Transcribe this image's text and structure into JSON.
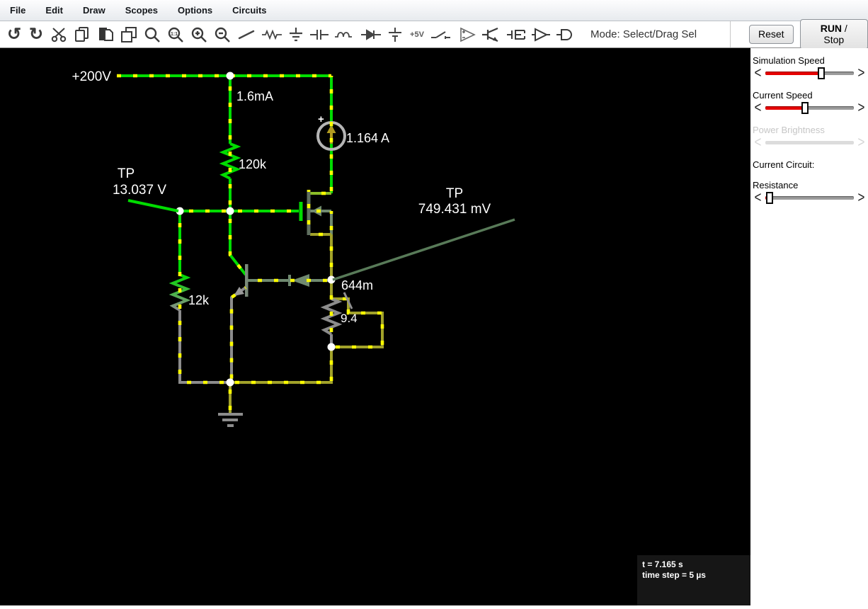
{
  "menu": {
    "items": [
      "File",
      "Edit",
      "Draw",
      "Scopes",
      "Options",
      "Circuits"
    ]
  },
  "toolbar": {
    "edit_icons": [
      "undo",
      "redo",
      "cut",
      "copy",
      "paste",
      "duplicate",
      "search",
      "zoom-100",
      "zoom-in",
      "zoom-out"
    ],
    "component_icons": [
      "wire",
      "resistor",
      "ground",
      "capacitor",
      "inductor",
      "diode",
      "voltage-source",
      "plus-5v",
      "switch",
      "op-amp",
      "transistor",
      "mosfet",
      "buffer",
      "logic-gate"
    ],
    "undo_glyph": "↺",
    "redo_glyph": "↻",
    "zoom100_label": "1:1",
    "plus5v_label": "+5V",
    "mode_label": "Mode: Select/Drag Sel",
    "reset_label": "Reset",
    "run_strong": "RUN",
    "run_rest": " / Stop"
  },
  "side_panel": {
    "sim_speed": {
      "label": "Simulation Speed",
      "fill_pct": 63
    },
    "current_speed": {
      "label": "Current Speed",
      "fill_pct": 45
    },
    "power_brightness": {
      "label": "Power Brightness",
      "fill_pct": null
    },
    "current_circuit_label": "Current Circuit:",
    "resistance": {
      "label": "Resistance",
      "fill_pct": 5
    }
  },
  "status": {
    "time": "t = 7.165 s",
    "timestep": "time step = 5 µs"
  },
  "circuit": {
    "labels": {
      "supply": "+200V",
      "branch_current": "1.6mA",
      "r1_value": "120k",
      "ammeter_plus": "+",
      "ammeter_reading": "1.164 A",
      "tp1_name": "TP",
      "tp1_value": "13.037 V",
      "tp2_name": "TP",
      "tp2_value": "749.431 mV",
      "r2_value": "12k",
      "node_current": "644m",
      "r3_value": "9.4"
    },
    "colors": {
      "wire_high": "#00dc00",
      "wire_mid": "#708a70",
      "wire_zero": "#8c8c8c",
      "wire_olive": "#a2a22a",
      "current_dot": "#ffff00",
      "node": "#ffffff",
      "ammeter_ring": "#b5b5b5"
    }
  }
}
